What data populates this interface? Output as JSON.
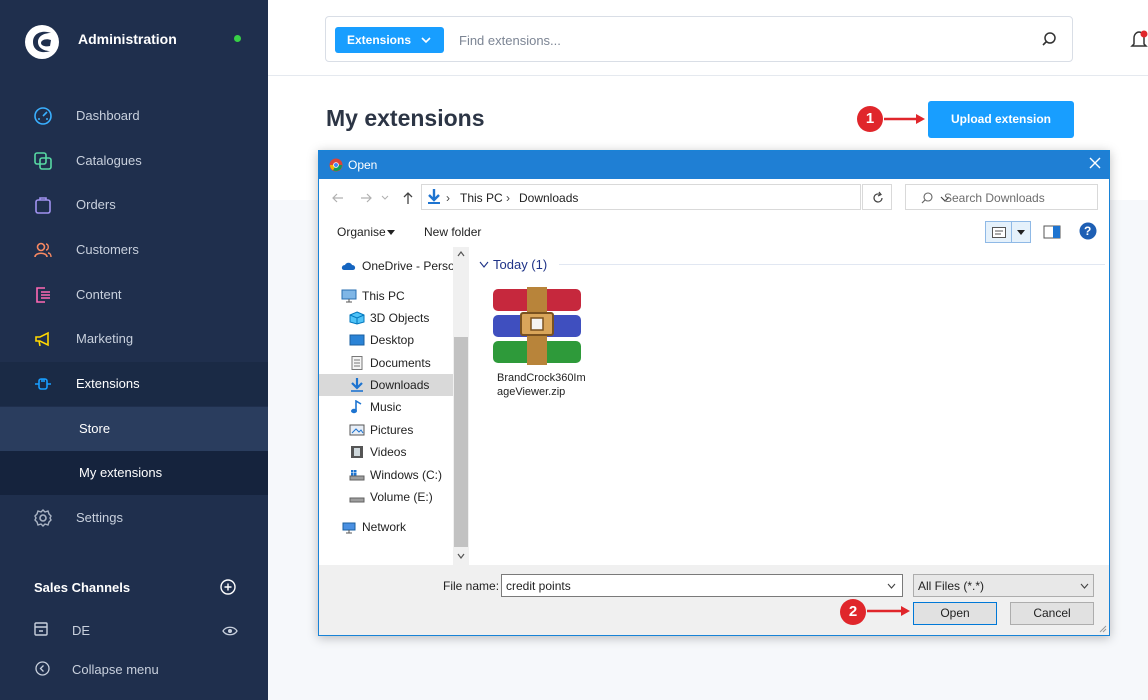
{
  "colors": {
    "sidebar_bg": "#1f2f4d",
    "accent_blue": "#189eff",
    "dialog_title_blue": "#1f7fd4",
    "annotation_red": "#e0262b",
    "online_green": "#37d046"
  },
  "sidebar": {
    "title": "Administration",
    "items": [
      {
        "label": "Dashboard",
        "icon": "dashboard-icon"
      },
      {
        "label": "Catalogues",
        "icon": "catalogues-icon"
      },
      {
        "label": "Orders",
        "icon": "orders-icon"
      },
      {
        "label": "Customers",
        "icon": "customers-icon"
      },
      {
        "label": "Content",
        "icon": "content-icon"
      },
      {
        "label": "Marketing",
        "icon": "megaphone-icon"
      },
      {
        "label": "Extensions",
        "icon": "extensions-icon"
      },
      {
        "label": "Settings",
        "icon": "gear-icon"
      }
    ],
    "sub_items": [
      {
        "label": "Store"
      },
      {
        "label": "My extensions"
      }
    ],
    "sales_channels_title": "Sales Channels",
    "channel": {
      "label": "DE"
    },
    "collapse_label": "Collapse menu"
  },
  "topbar": {
    "search_scope": "Extensions",
    "search_placeholder": "Find extensions..."
  },
  "main": {
    "title": "My extensions",
    "upload_button": "Upload extension"
  },
  "annotations": {
    "step1": "1",
    "step2": "2"
  },
  "dialog": {
    "title": "Open",
    "breadcrumb": [
      "This PC",
      "Downloads"
    ],
    "search_placeholder": "Search Downloads",
    "organise": "Organise",
    "new_folder": "New folder",
    "help_symbol": "?",
    "tree": [
      {
        "label": "OneDrive - Persor",
        "icon": "onedrive-icon"
      },
      {
        "label": "This PC",
        "icon": "computer-icon"
      },
      {
        "label": "3D Objects",
        "icon": "3d-objects-icon"
      },
      {
        "label": "Desktop",
        "icon": "desktop-icon"
      },
      {
        "label": "Documents",
        "icon": "documents-icon"
      },
      {
        "label": "Downloads",
        "icon": "download-arrow-icon"
      },
      {
        "label": "Music",
        "icon": "music-icon"
      },
      {
        "label": "Pictures",
        "icon": "pictures-icon"
      },
      {
        "label": "Videos",
        "icon": "videos-icon"
      },
      {
        "label": "Windows (C:)",
        "icon": "windows-drive-icon"
      },
      {
        "label": "Volume (E:)",
        "icon": "drive-icon"
      },
      {
        "label": "Network",
        "icon": "network-icon"
      }
    ],
    "group_header": "Today (1)",
    "files": [
      {
        "name": "BrandCrock360ImageViewer.zip",
        "icon": "winrar-archive-icon"
      }
    ],
    "file_name_label": "File name:",
    "file_name_value": "credit points",
    "file_type": "All Files (*.*)",
    "open_button": "Open",
    "cancel_button": "Cancel"
  }
}
